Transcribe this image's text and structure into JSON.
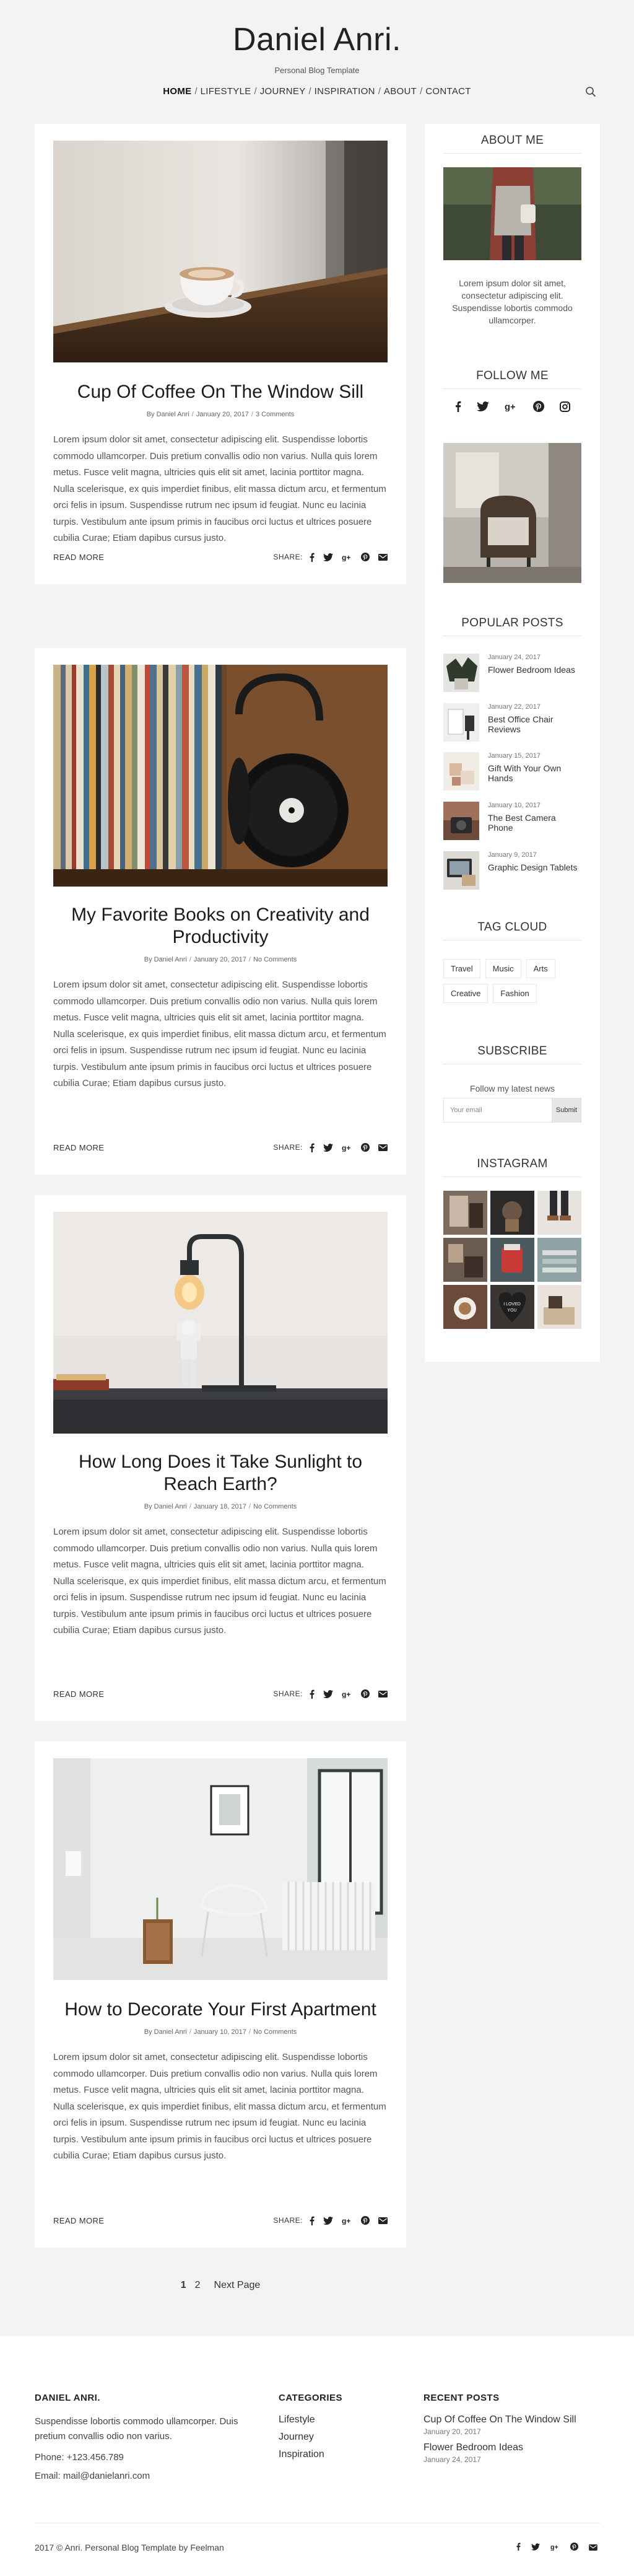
{
  "header": {
    "title": "Daniel Anri.",
    "tagline": "Personal Blog Template",
    "nav": [
      "HOME",
      "LIFESTYLE",
      "JOURNEY",
      "INSPIRATION",
      "ABOUT",
      "CONTACT"
    ],
    "nav_active": "HOME"
  },
  "posts": [
    {
      "title": "Cup Of Coffee On The Window Sill",
      "author": "By Daniel Anri",
      "date": "January 20, 2017",
      "comments": "3 Comments",
      "excerpt": "Lorem ipsum dolor sit amet, consectetur adipiscing elit. Suspendisse lobortis commodo ullamcorper. Duis pretium convallis odio non varius. Nulla quis lorem metus. Fusce velit magna, ultricies quis elit sit amet, lacinia porttitor magna. Nulla scelerisque, ex quis imperdiet finibus, elit massa dictum arcu, et fermentum orci felis in ipsum. Suspendisse rutrum nec ipsum id feugiat. Nunc eu lacinia turpis. Vestibulum ante ipsum primis in faucibus orci luctus et ultrices posuere cubilia Curae; Etiam dapibus cursus justo.",
      "read_more": "READ MORE",
      "share_label": "SHARE:"
    },
    {
      "title": "My Favorite Books on Creativity and Productivity",
      "author": "By Daniel Anri",
      "date": "January 20, 2017",
      "comments": "No Comments",
      "excerpt": "Lorem ipsum dolor sit amet, consectetur adipiscing elit. Suspendisse lobortis commodo ullamcorper. Duis pretium convallis odio non varius. Nulla quis lorem metus. Fusce velit magna, ultricies quis elit sit amet, lacinia porttitor magna. Nulla scelerisque, ex quis imperdiet finibus, elit massa dictum arcu, et fermentum orci felis in ipsum. Suspendisse rutrum nec ipsum id feugiat. Nunc eu lacinia turpis. Vestibulum ante ipsum primis in faucibus orci luctus et ultrices posuere cubilia Curae; Etiam dapibus cursus justo.",
      "read_more": "READ MORE",
      "share_label": "SHARE:"
    },
    {
      "title": "How Long Does it Take Sunlight to Reach Earth?",
      "author": "By Daniel Anri",
      "date": "January 18, 2017",
      "comments": "No Comments",
      "excerpt": "Lorem ipsum dolor sit amet, consectetur adipiscing elit. Suspendisse lobortis commodo ullamcorper. Duis pretium convallis odio non varius. Nulla quis lorem metus. Fusce velit magna, ultricies quis elit sit amet, lacinia porttitor magna. Nulla scelerisque, ex quis imperdiet finibus, elit massa dictum arcu, et fermentum orci felis in ipsum. Suspendisse rutrum nec ipsum id feugiat. Nunc eu lacinia turpis. Vestibulum ante ipsum primis in faucibus orci luctus et ultrices posuere cubilia Curae; Etiam dapibus cursus justo.",
      "read_more": "READ MORE",
      "share_label": "SHARE:"
    },
    {
      "title": "How to Decorate Your First Apartment",
      "author": "By Daniel Anri",
      "date": "January 10, 2017",
      "comments": "No Comments",
      "excerpt": "Lorem ipsum dolor sit amet, consectetur adipiscing elit. Suspendisse lobortis commodo ullamcorper. Duis pretium convallis odio non varius. Nulla quis lorem metus. Fusce velit magna, ultricies quis elit sit amet, lacinia porttitor magna. Nulla scelerisque, ex quis imperdiet finibus, elit massa dictum arcu, et fermentum orci felis in ipsum. Suspendisse rutrum nec ipsum id feugiat. Nunc eu lacinia turpis. Vestibulum ante ipsum primis in faucibus orci luctus et ultrices posuere cubilia Curae; Etiam dapibus cursus justo.",
      "read_more": "READ MORE",
      "share_label": "SHARE:"
    }
  ],
  "sidebar": {
    "about": {
      "title": "ABOUT ME",
      "text": "Lorem ipsum dolor sit amet, consectetur adipiscing elit. Suspendisse lobortis commodo ullamcorper."
    },
    "follow": {
      "title": "FOLLOW ME",
      "icons": [
        "facebook-icon",
        "twitter-icon",
        "google-plus-icon",
        "pinterest-icon",
        "instagram-icon"
      ]
    },
    "popular": {
      "title": "POPULAR POSTS",
      "items": [
        {
          "date": "January 24, 2017",
          "title": "Flower Bedroom Ideas"
        },
        {
          "date": "January 22, 2017",
          "title": "Best Office Chair Reviews"
        },
        {
          "date": "January 15, 2017",
          "title": "Gift With Your Own Hands"
        },
        {
          "date": "January 10, 2017",
          "title": "The Best Camera Phone"
        },
        {
          "date": "January 9, 2017",
          "title": "Graphic Design Tablets"
        }
      ]
    },
    "tags": {
      "title": "TAG CLOUD",
      "items": [
        "Travel",
        "Music",
        "Arts",
        "Creative",
        "Fashion"
      ]
    },
    "subscribe": {
      "title": "SUBSCRIBE",
      "note": "Follow my latest news",
      "placeholder": "Your email",
      "button": "Submit"
    },
    "instagram": {
      "title": "INSTAGRAM"
    }
  },
  "pagination": {
    "pages": [
      "1",
      "2"
    ],
    "current": "1",
    "next": "Next Page"
  },
  "footer": {
    "about_heading": "DANIEL ANRI.",
    "about_text": "Suspendisse lobortis commodo ullamcorper. Duis pretium convallis odio non varius.",
    "phone": "Phone: +123.456.789",
    "email": "Email: mail@danielanri.com",
    "categories_heading": "CATEGORIES",
    "categories": [
      "Lifestyle",
      "Journey",
      "Inspiration"
    ],
    "recent_heading": "RECENT POSTS",
    "recent": [
      {
        "title": "Cup Of Coffee On The Window Sill",
        "date": "January 20, 2017"
      },
      {
        "title": "Flower Bedroom Ideas",
        "date": "January 24, 2017"
      }
    ],
    "copyright": "2017 © Anri. Personal Blog Template by Feelman"
  },
  "colors": {
    "background": "#f3f3f3",
    "card": "#ffffff",
    "text": "#222222"
  }
}
